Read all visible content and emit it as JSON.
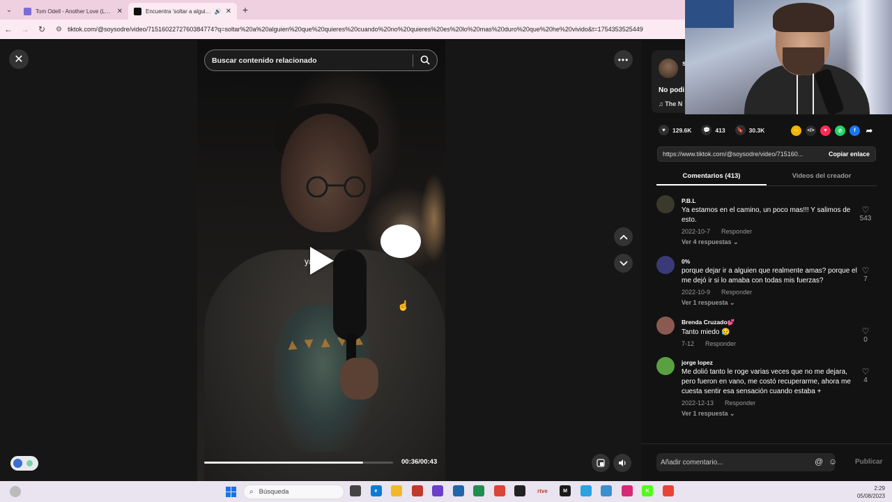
{
  "browser": {
    "tabs": [
      {
        "title": "Tom Odell - Another Love (Lyri…",
        "favicon_color": "#7a6bd6",
        "active": false
      },
      {
        "title": "Encuentra 'soltar a alguien q…",
        "favicon_color": "#111111",
        "active": true
      }
    ],
    "url": "tiktok.com/@soysodre/video/7151602272760384774?q=soltar%20a%20alguien%20que%20quieres%20cuando%20no%20quieres%20es%20lo%20mas%20duro%20que%20he%20vivido&t=1754353525449"
  },
  "player": {
    "search_placeholder": "Buscar contenido relacionado",
    "subtitle": "ya",
    "progress_fraction": 0.84,
    "time": "00:36/00:43"
  },
  "panel": {
    "author_initial": "s",
    "description": "No podi",
    "music": "The N",
    "likes": "129.6K",
    "comments_count": "413",
    "saves": "30.3K",
    "share_colors": [
      "#f2b400",
      "#2b2b2b",
      "#fe2c55",
      "#25d366",
      "#1877f2"
    ],
    "link_url": "https://www.tiktok.com/@soysodre/video/715160...",
    "copy_label": "Copiar enlace",
    "tab_comments": "Comentarios (413)",
    "tab_creator": "Videos del creador",
    "add_comment_placeholder": "Añadir comentario...",
    "publish_label": "Publicar"
  },
  "comments": [
    {
      "user": "P.B.L",
      "text": "Ya estamos en el camino, un poco mas!!! Y salimos de esto.",
      "date": "2022-10-7",
      "reply": "Responder",
      "replies": "Ver 4 respuestas",
      "likes": "543",
      "avatar_color": "#3a3a2a"
    },
    {
      "user": "0%",
      "text": "porque dejar ir a alguien que realmente amas? porque el me dejó ir si lo amaba con todas mis fuerzas?",
      "date": "2022-10-9",
      "reply": "Responder",
      "replies": "Ver 1 respuesta",
      "likes": "7",
      "avatar_color": "#3b3a78"
    },
    {
      "user": "Brenda Cruzado💕",
      "text": "Tanto miedo 😥",
      "date": "7-12",
      "reply": "Responder",
      "replies": "",
      "likes": "0",
      "avatar_color": "#8a5a50"
    },
    {
      "user": "jorge lopez",
      "text": "Me dolió tanto le roge varias veces que no me dejara, pero fueron en vano, me costó recuperarme, ahora me cuesta sentir esa sensación cuando estaba +",
      "date": "2022-12-13",
      "reply": "Responder",
      "replies": "Ver 1 respuesta",
      "likes": "4",
      "avatar_color": "#5aa040"
    }
  ],
  "taskbar": {
    "search_placeholder": "Búsqueda",
    "apps": [
      {
        "label": "",
        "color": "#444444"
      },
      {
        "label": "e",
        "color": "#0c7bd8"
      },
      {
        "label": "",
        "color": "#f3b829"
      },
      {
        "label": "",
        "color": "#c0392b"
      },
      {
        "label": "",
        "color": "#6a3fc9"
      },
      {
        "label": "",
        "color": "#2266aa"
      },
      {
        "label": "",
        "color": "#1f8f4e"
      },
      {
        "label": "",
        "color": "#db4437"
      },
      {
        "label": "",
        "color": "#222222"
      },
      {
        "label": "rtve",
        "color": "#e8e4ef"
      },
      {
        "label": "M",
        "color": "#1a1a1a"
      },
      {
        "label": "",
        "color": "#2aa3e0"
      },
      {
        "label": "",
        "color": "#3a8fd0"
      },
      {
        "label": "",
        "color": "#d62976"
      },
      {
        "label": "K",
        "color": "#53fc18"
      },
      {
        "label": "",
        "color": "#ea4335"
      }
    ],
    "time": "2:29",
    "date": "05/08/2023"
  }
}
